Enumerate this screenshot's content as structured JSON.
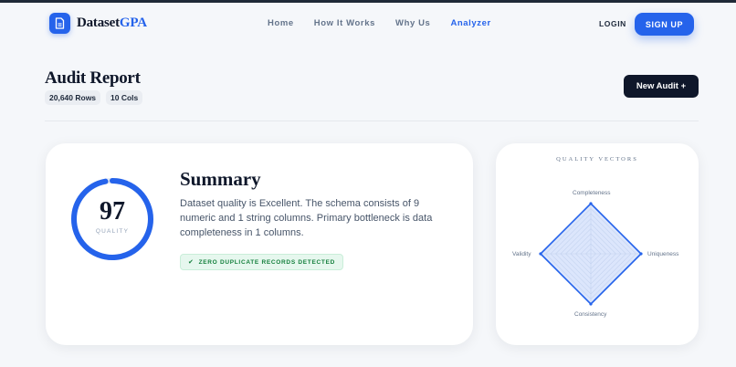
{
  "nav": {
    "brand_prefix": "Dataset",
    "brand_accent": "GPA",
    "links": [
      "Home",
      "How It Works",
      "Why Us",
      "Analyzer"
    ],
    "active_link": "Analyzer",
    "login": "LOGIN",
    "signup": "SIGN UP"
  },
  "header": {
    "title": "Audit Report",
    "rows": "20,640 Rows",
    "cols": "10 Cols",
    "new_audit": "New Audit +"
  },
  "summary": {
    "score": "97",
    "score_fraction": 0.97,
    "score_label": "QUALITY",
    "title": "Summary",
    "text": "Dataset quality is Excellent. The schema consists of 9 numeric and 1 string columns. Primary bottleneck is data completeness in 1 columns.",
    "badge": "ZERO DUPLICATE RECORDS DETECTED"
  },
  "vectors": {
    "title": "QUALITY VECTORS",
    "axes": [
      "Completeness",
      "Uniqueness",
      "Consistency",
      "Validity"
    ],
    "values": [
      1.0,
      1.0,
      1.0,
      1.0
    ]
  },
  "colors": {
    "accent": "#2563eb",
    "dark": "#0f172a",
    "success": "#15803d"
  }
}
